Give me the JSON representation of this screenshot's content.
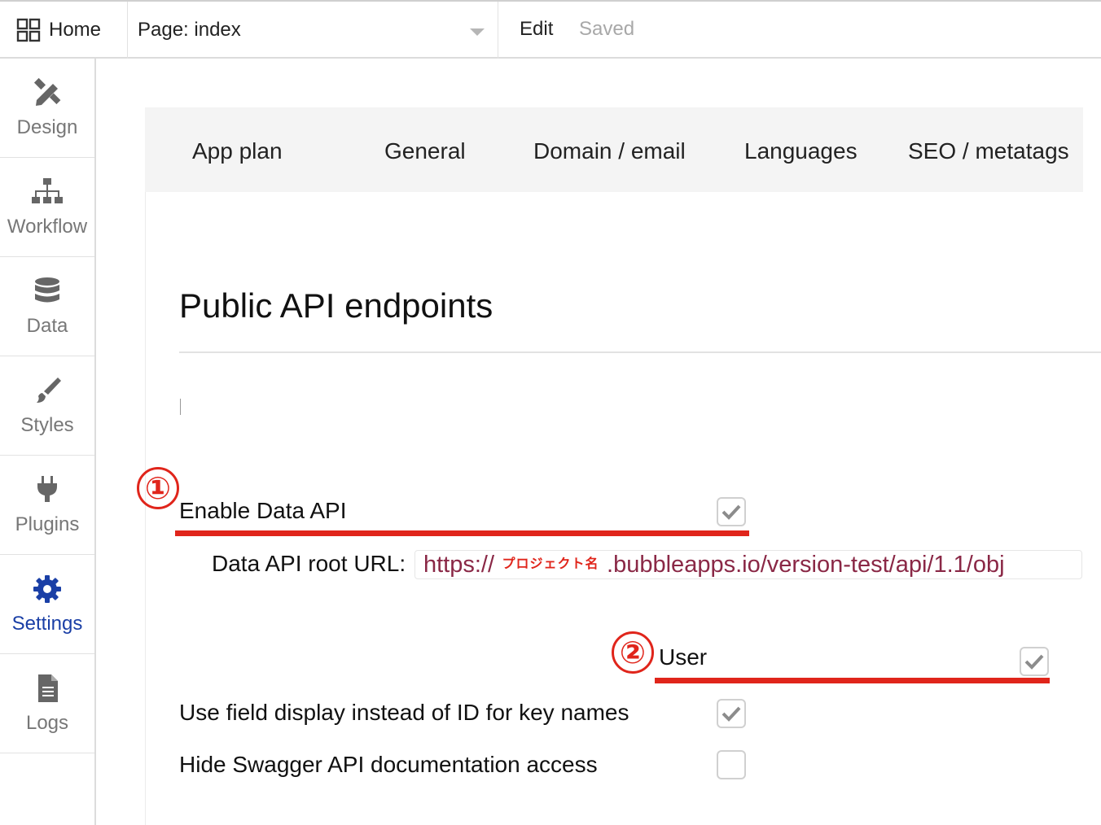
{
  "topbar": {
    "home_label": "Home",
    "page_selector": "Page: index",
    "edit_label": "Edit",
    "save_status": "Saved"
  },
  "sidebar": {
    "items": [
      {
        "label": "Design",
        "icon": "design-icon"
      },
      {
        "label": "Workflow",
        "icon": "workflow-icon"
      },
      {
        "label": "Data",
        "icon": "database-icon"
      },
      {
        "label": "Styles",
        "icon": "brush-icon"
      },
      {
        "label": "Plugins",
        "icon": "plug-icon"
      },
      {
        "label": "Settings",
        "icon": "gear-icon",
        "active": true
      },
      {
        "label": "Logs",
        "icon": "document-icon"
      }
    ]
  },
  "tabs": [
    "App plan",
    "General",
    "Domain / email",
    "Languages",
    "SEO / metatags"
  ],
  "section": {
    "title": "Public API endpoints"
  },
  "options": {
    "enable_data_api": {
      "label": "Enable Data API",
      "checked": true
    },
    "data_api_root_url": {
      "label": "Data API root URL:",
      "prefix": "https://",
      "redaction": "プロジェクト名",
      "suffix": ".bubbleapps.io/version-test/api/1.1/obj"
    },
    "user": {
      "label": "User",
      "checked": true
    },
    "use_field_display": {
      "label": "Use field display instead of ID for key names",
      "checked": true
    },
    "hide_swagger": {
      "label": "Hide Swagger API documentation access",
      "checked": false
    }
  },
  "annotations": {
    "marker_1": "①",
    "marker_2": "②",
    "color": "#e0251b"
  },
  "colors": {
    "accent": "#1a3fa6",
    "url_text": "#8a2846",
    "check": "#8c8c8c"
  }
}
